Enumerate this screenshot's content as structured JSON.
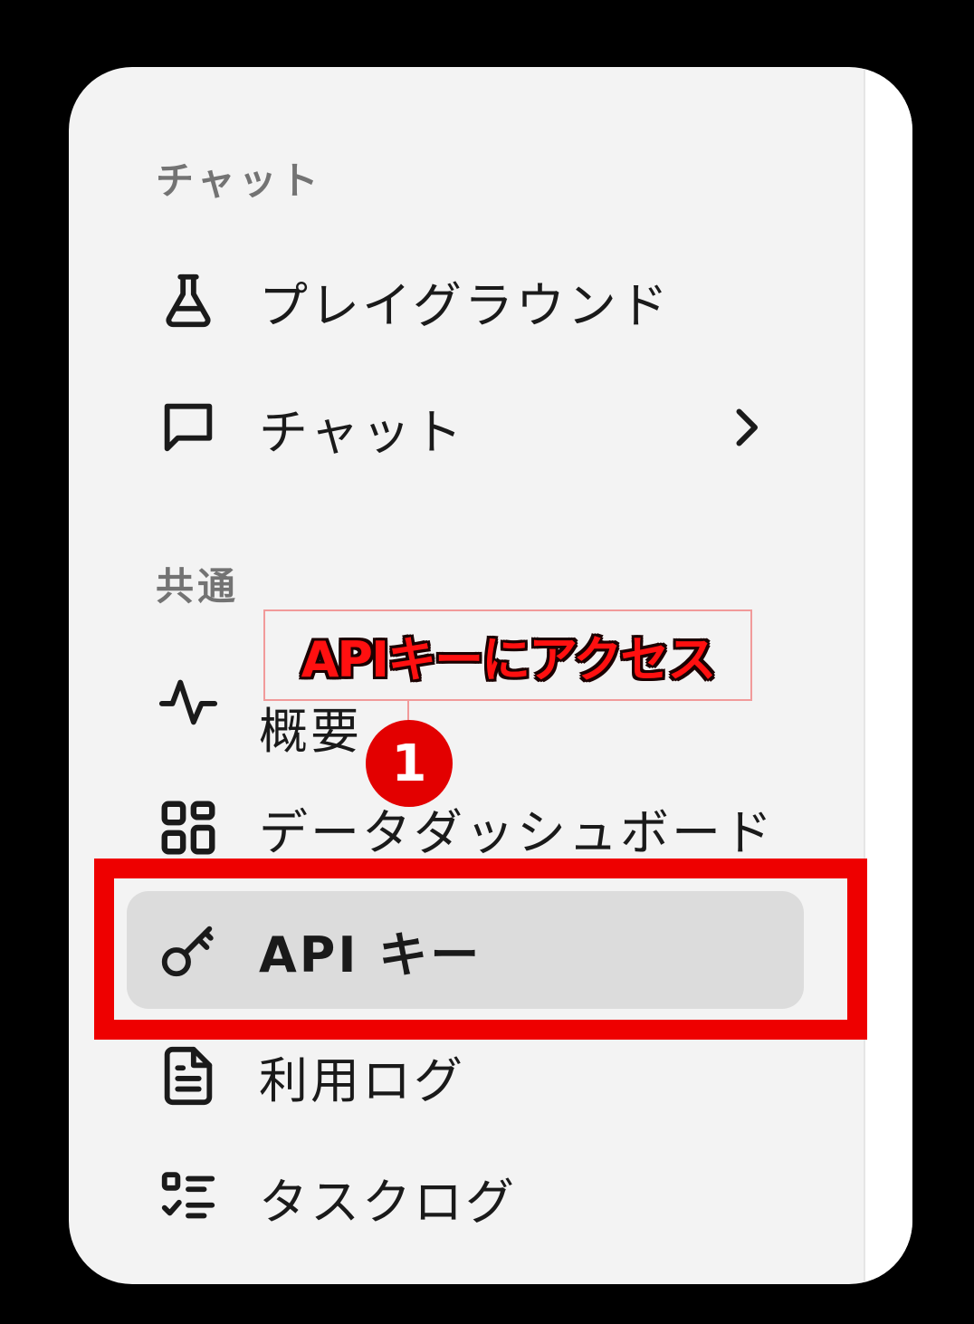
{
  "sections": {
    "chat_heading": "チャット",
    "common_heading": "共通"
  },
  "menu": {
    "playground": {
      "label": "プレイグラウンド",
      "icon": "flask-icon"
    },
    "chat": {
      "label": "チャット",
      "icon": "message-square-icon",
      "trailing_icon": "chevron-right-icon"
    },
    "overview": {
      "label": "概要",
      "icon": "activity-icon"
    },
    "dashboard": {
      "label": "データダッシュボード",
      "icon": "grid-icon"
    },
    "api_keys": {
      "label": "API キー",
      "icon": "key-icon",
      "selected": true
    },
    "usage_logs": {
      "label": "利用ログ",
      "icon": "file-text-icon"
    },
    "task_logs": {
      "label": "タスクログ",
      "icon": "list-checks-icon"
    }
  },
  "annotation": {
    "callout_text": "APIキーにアクセス",
    "step_number": "1",
    "highlight_color": "#ee0000",
    "callout_text_color": "#ff1010"
  },
  "colors": {
    "panel_background": "#f3f3f3",
    "selected_background": "#dcdcdc",
    "section_label": "#737373",
    "text": "#1a1a1a",
    "badge": "#e30000"
  }
}
